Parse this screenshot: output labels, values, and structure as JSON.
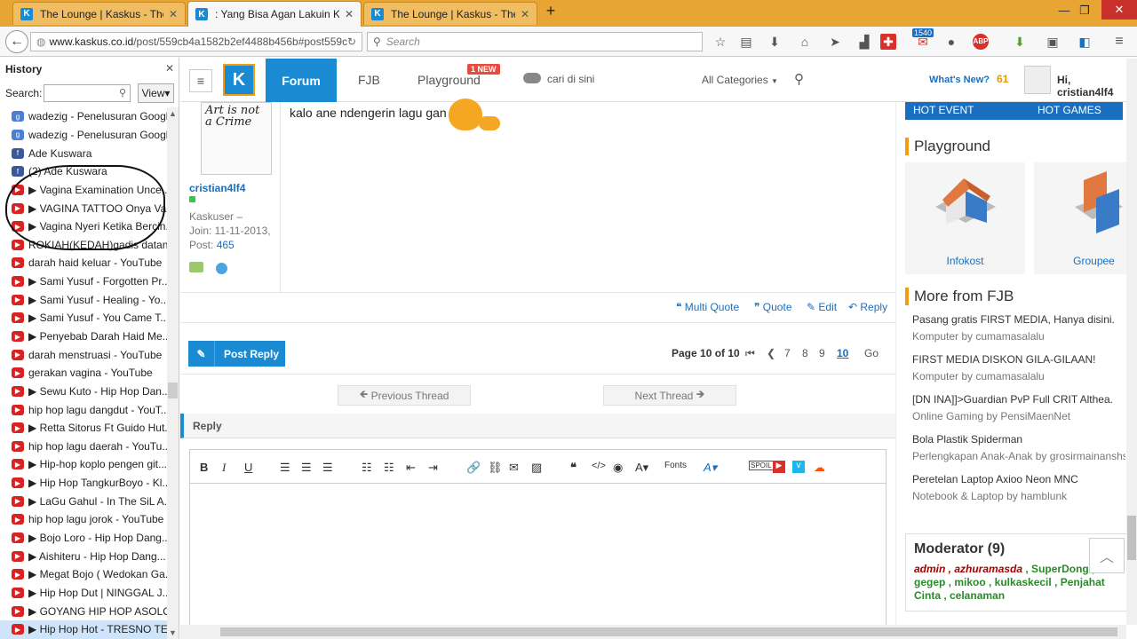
{
  "browser": {
    "tabs": [
      {
        "title": "The Lounge | Kaskus - The ...",
        "active": false
      },
      {
        "title": ": Yang Bisa Agan Lakuin K...",
        "active": true
      },
      {
        "title": "The Lounge | Kaskus - The ...",
        "active": false
      }
    ],
    "url_domain": "www.kaskus.co.id",
    "url_path": "/post/559cb4a1582b2ef4488b456b#post559cb",
    "search_placeholder": "Search",
    "gmail_badge": "1540",
    "colors": {
      "tabbar": "#e8a533",
      "accent": "#1a8ad3"
    }
  },
  "sidebar": {
    "title": "History",
    "search_label": "Search:",
    "view_label": "View",
    "items": [
      {
        "label": "wadezig - Penelusuran Google",
        "icon": "google-icon"
      },
      {
        "label": "wadezig - Penelusuran Google",
        "icon": "google-icon"
      },
      {
        "label": "Ade Kuswara",
        "icon": "facebook-icon"
      },
      {
        "label": "(2) Ade Kuswara",
        "icon": "facebook-icon"
      },
      {
        "label": "▶ Vagina Examination Unce...",
        "icon": "youtube-icon"
      },
      {
        "label": "▶ VAGINA TATTOO Onya Va...",
        "icon": "youtube-icon"
      },
      {
        "label": "▶ Vagina Nyeri Ketika Bercin...",
        "icon": "youtube-icon"
      },
      {
        "label": "ROKIAH(KEDAH)gadis datan...",
        "icon": "youtube-icon"
      },
      {
        "label": "darah haid keluar - YouTube",
        "icon": "youtube-icon"
      },
      {
        "label": "▶ Sami Yusuf - Forgotten Pr...",
        "icon": "youtube-icon"
      },
      {
        "label": "▶ Sami Yusuf - Healing - Yo...",
        "icon": "youtube-icon"
      },
      {
        "label": "▶ Sami Yusuf - You Came T...",
        "icon": "youtube-icon"
      },
      {
        "label": "▶ Penyebab Darah Haid Me...",
        "icon": "youtube-icon"
      },
      {
        "label": "darah menstruasi - YouTube",
        "icon": "youtube-icon"
      },
      {
        "label": "gerakan vagina - YouTube",
        "icon": "youtube-icon"
      },
      {
        "label": "▶ Sewu Kuto - Hip Hop Dan...",
        "icon": "youtube-icon"
      },
      {
        "label": "hip hop lagu dangdut - YouT...",
        "icon": "youtube-icon"
      },
      {
        "label": "▶ Retta Sitorus Ft Guido Hut...",
        "icon": "youtube-icon"
      },
      {
        "label": "hip hop lagu daerah - YouTu...",
        "icon": "youtube-icon"
      },
      {
        "label": "▶ Hip-hop koplo pengen git...",
        "icon": "youtube-icon"
      },
      {
        "label": "▶ Hip Hop TangkurBoyo - Kl...",
        "icon": "youtube-icon"
      },
      {
        "label": "▶ LaGu Gahul - In The SiL A...",
        "icon": "youtube-icon"
      },
      {
        "label": "hip hop lagu jorok - YouTube",
        "icon": "youtube-icon"
      },
      {
        "label": "▶ Bojo Loro - Hip Hop Dang...",
        "icon": "youtube-icon"
      },
      {
        "label": "▶ Aishiteru - Hip Hop Dang...",
        "icon": "youtube-icon"
      },
      {
        "label": "▶ Megat Bojo ( Wedokan Ga...",
        "icon": "youtube-icon"
      },
      {
        "label": "▶ Hip Hop Dut | NINGGAL J...",
        "icon": "youtube-icon"
      },
      {
        "label": "▶ GOYANG HIP HOP ASOLO...",
        "icon": "youtube-icon"
      },
      {
        "label": "▶ Hip Hop Hot - TRESNO TE...",
        "icon": "youtube-icon"
      }
    ]
  },
  "header": {
    "logo": "K",
    "forum": "Forum",
    "fjb": "FJB",
    "playground": "Playground",
    "new_badge": "1 NEW",
    "search_placeholder": "cari di sini",
    "category": "All Categories",
    "whats_new": "What's New?",
    "whats_new_count": "61",
    "greeting": "Hi, cristian4lf4"
  },
  "post": {
    "avatar_text": "Art is not a Crime",
    "username": "cristian4lf4",
    "rank": "Kaskuser –",
    "join": "Join: 11-11-2013,",
    "post_label": "Post:",
    "post_count": "465",
    "text": "kalo ane ndengerin lagu gan",
    "actions": {
      "multi_quote": "Multi Quote",
      "quote": "Quote",
      "edit": "Edit",
      "reply": "Reply"
    }
  },
  "pagination": {
    "post_reply": "Post Reply",
    "page_label": "Page 10 of 10",
    "pages": [
      "7",
      "8",
      "9",
      "10"
    ],
    "go": "Go",
    "prev_thread": "Previous Thread",
    "next_thread": "Next Thread"
  },
  "reply": {
    "title": "Reply",
    "fonts_label": "Fonts"
  },
  "right": {
    "hot_event": "HOT EVENT",
    "hot_games": "HOT GAMES",
    "playground_title": "Playground",
    "playground_items": [
      "Infokost",
      "Groupee"
    ],
    "fjb_title": "More from FJB",
    "fjb_items": [
      {
        "title": "Pasang gratis FIRST MEDIA, Hanya disini.",
        "sub": "Komputer by cumamasalalu"
      },
      {
        "title": "FIRST MEDIA DISKON GILA-GILAAN!",
        "sub": "Komputer by cumamasalalu"
      },
      {
        "title": "[DN INA]]>Guardian PvP Full CRIT Althea.",
        "sub": "Online Gaming by PensiMaenNet"
      },
      {
        "title": "Bola Plastik Spiderman",
        "sub": "Perlengkapan Anak-Anak by grosirmainanshs"
      },
      {
        "title": "Peretelan Laptop Axioo Neon MNC",
        "sub": "Notebook & Laptop by hamblunk"
      }
    ],
    "moderator_title": "Moderator (9)",
    "moderators_red": "admin , azhuramasda",
    "moderators_green": ", SuperDong , gegep , mikoo , kulkaskecil , Penjahat Cinta , celanaman"
  }
}
